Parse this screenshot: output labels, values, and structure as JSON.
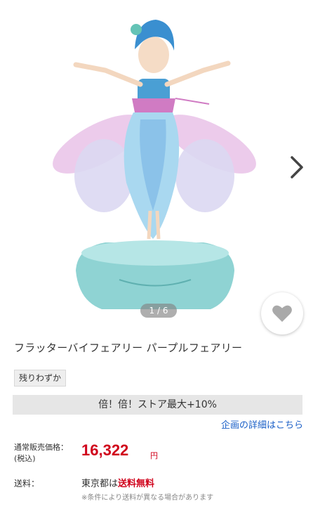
{
  "gallery": {
    "page_current": "1",
    "page_separator": "/",
    "page_total": "6",
    "next_icon": "chevron-right-icon",
    "favorite_icon": "heart-icon"
  },
  "product": {
    "title": "フラッターバイフェアリー パープルフェアリー",
    "stock_badge": "残りわずか"
  },
  "promo": {
    "banner_text": "倍！倍！ストア最大+10%",
    "detail_link": "企画の詳細はこちら"
  },
  "price": {
    "label_line1": "通常販売価格：",
    "label_line2": "(税込)",
    "amount": "16,322",
    "unit": "円"
  },
  "shipping": {
    "label": "送料：",
    "region": "東京都は",
    "free_text": "送料無料",
    "note": "※条件により送料が異なる場合があります"
  },
  "colors": {
    "price_red": "#d0021b",
    "link_blue": "#1a5fc7"
  }
}
